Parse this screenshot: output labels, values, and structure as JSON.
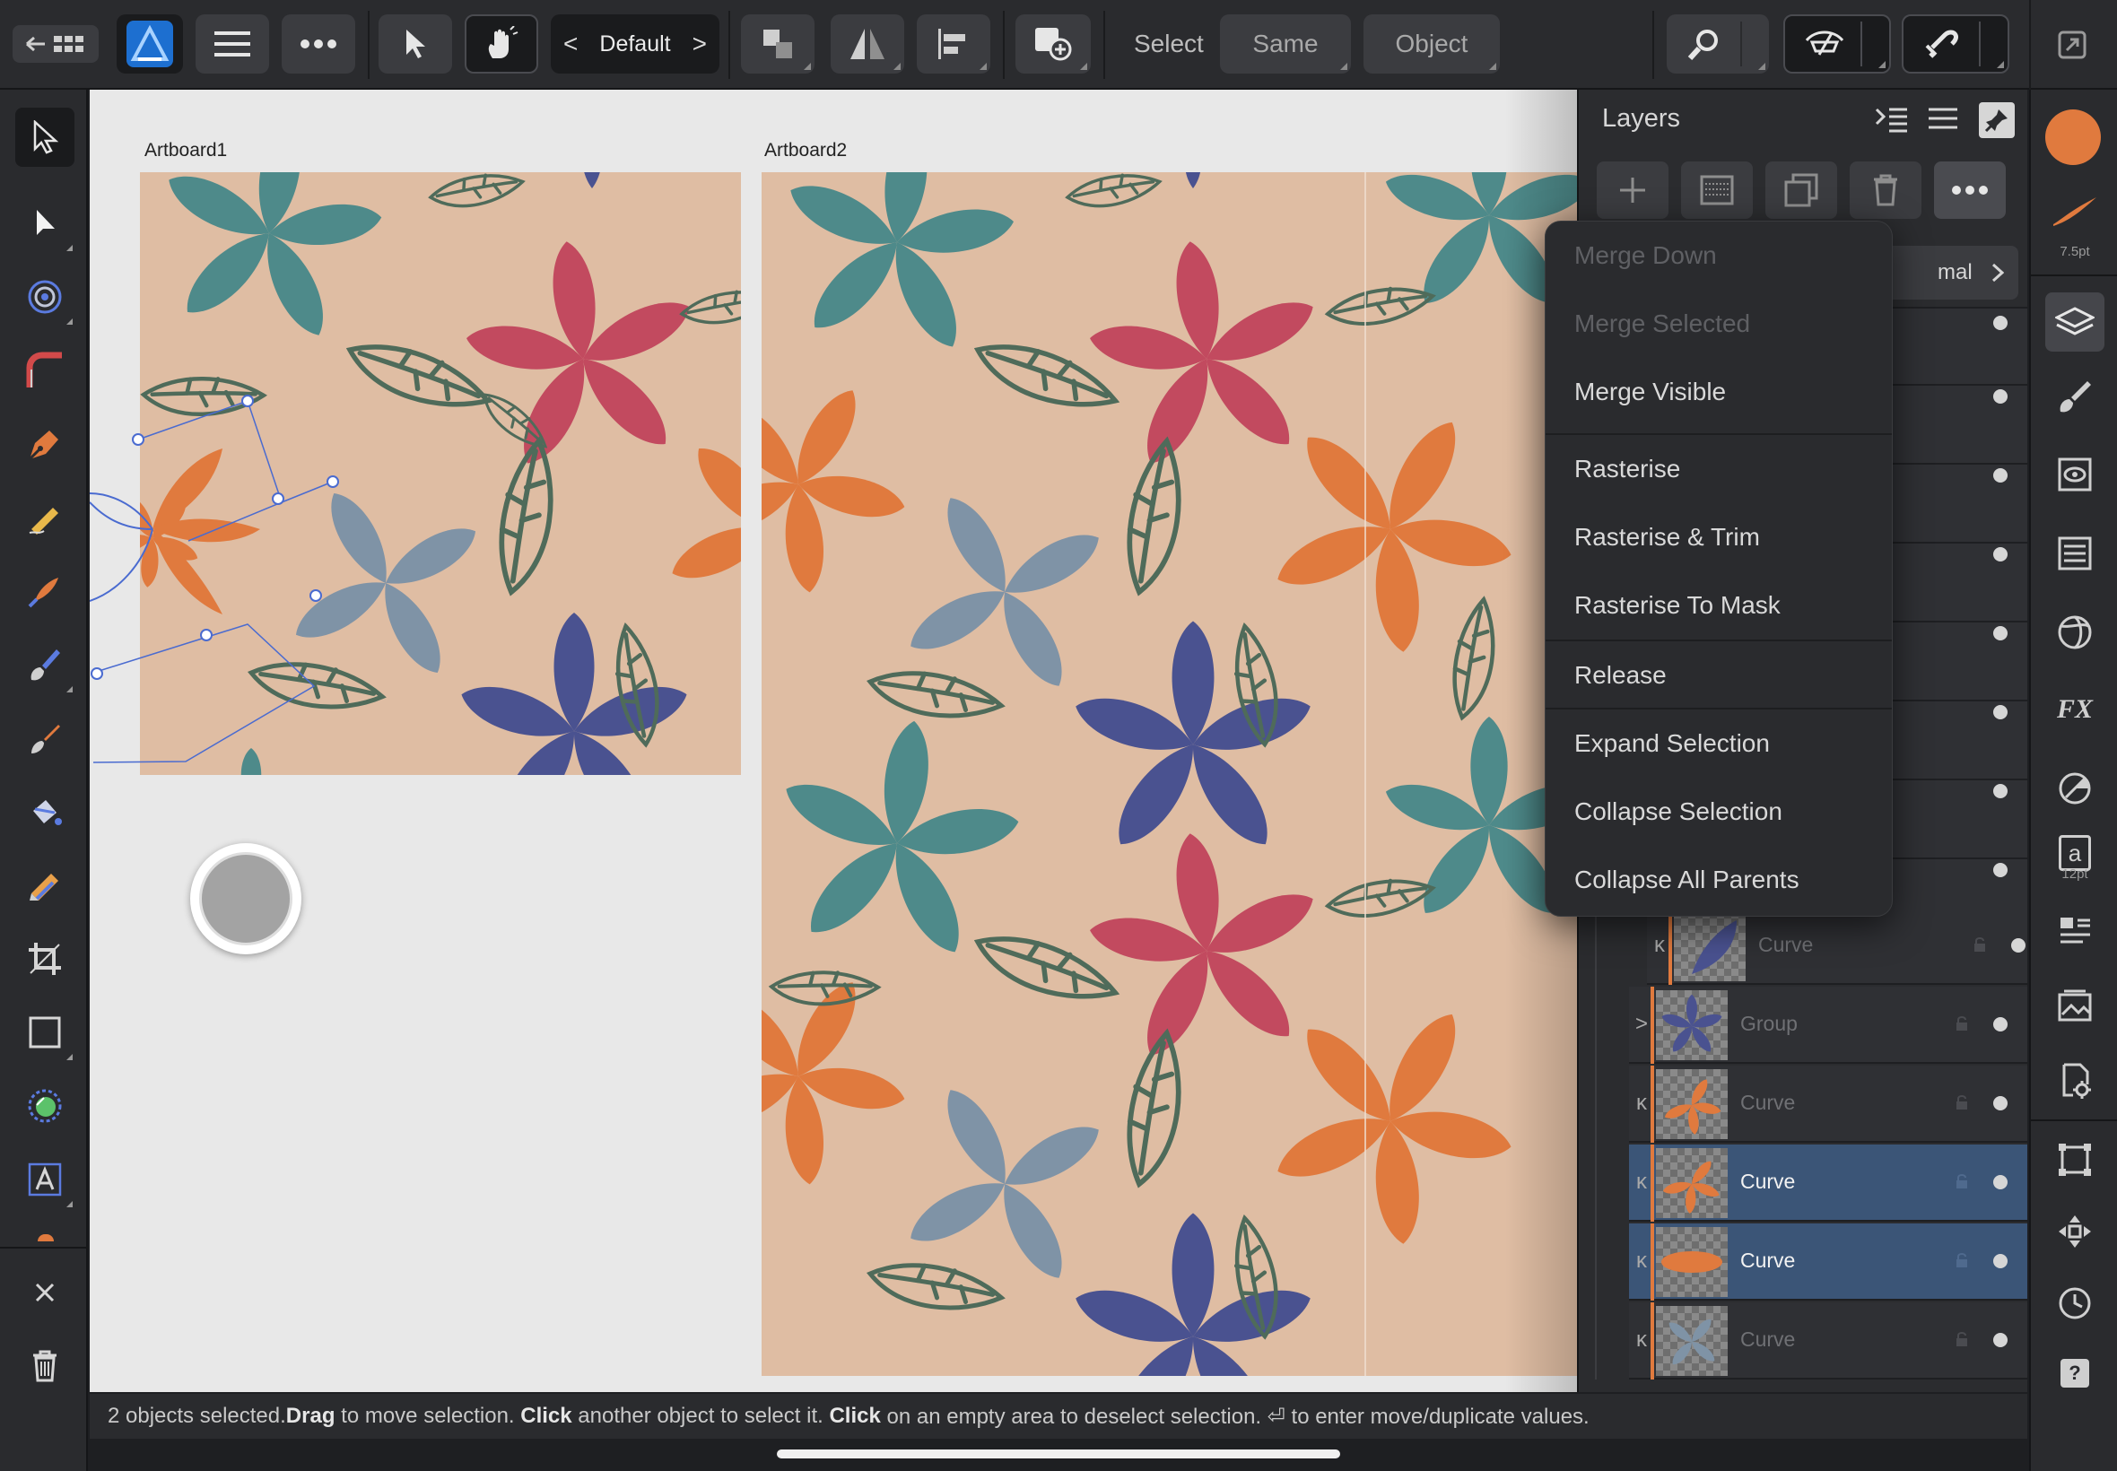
{
  "toolbar": {
    "back_icon": "back-grid-icon",
    "persona": "designer-persona-icon",
    "menu_icon": "hamburger-icon",
    "more_icon": "ellipsis-icon",
    "move_tool_icon": "pointer-icon",
    "gesture_icon": "hand-gesture-icon",
    "preset_prev": "<",
    "preset_label": "Default",
    "preset_next": ">",
    "select_label": "Select",
    "same_label": "Same",
    "object_label": "Object"
  },
  "artboards": [
    {
      "label": "Artboard1"
    },
    {
      "label": "Artboard2"
    }
  ],
  "layers_panel": {
    "title": "Layers",
    "blend_mode_partial": "mal",
    "rows": [
      {
        "name": "Curve",
        "selected": false,
        "expander": "ĸ"
      },
      {
        "name": "Group",
        "selected": false,
        "expander": ">"
      },
      {
        "name": "Curve",
        "selected": false,
        "expander": "ĸ"
      },
      {
        "name": "Curve",
        "selected": true,
        "expander": "ĸ"
      },
      {
        "name": "Curve",
        "selected": true,
        "expander": "ĸ"
      },
      {
        "name": "Curve",
        "selected": false,
        "expander": "ĸ"
      }
    ]
  },
  "context_menu": {
    "items": [
      {
        "label": "Merge Down",
        "enabled": false
      },
      {
        "label": "Merge Selected",
        "enabled": false
      },
      {
        "label": "Merge Visible",
        "enabled": true
      },
      {
        "label": "Rasterise",
        "enabled": true
      },
      {
        "label": "Rasterise & Trim",
        "enabled": true
      },
      {
        "label": "Rasterise To Mask",
        "enabled": true
      },
      {
        "label": "Release",
        "enabled": true
      },
      {
        "label": "Expand Selection",
        "enabled": true
      },
      {
        "label": "Collapse Selection",
        "enabled": true
      },
      {
        "label": "Collapse All Parents",
        "enabled": true
      }
    ]
  },
  "right_bar": {
    "stroke_size": "7.5pt",
    "text_size": "12pt",
    "text_glyph": "a",
    "fx_label": "FX",
    "help_glyph": "?"
  },
  "status": {
    "part1": "2 objects selected. ",
    "bold1": "Drag",
    "part2": " to move selection. ",
    "bold2": "Click",
    "part3": " another object to select it. ",
    "bold3": "Click",
    "part4": " on an empty area to deselect selection. ⏎ to enter move/duplicate values."
  },
  "colors": {
    "accent_orange": "#e07a3e",
    "selection_blue": "#3b5577",
    "pattern_bg": "#dfbda3",
    "teal": "#4e8a8a",
    "crimson": "#c24a5f",
    "slate": "#7f93a6",
    "indigo": "#4a5290",
    "leaf": "#4f6b5a"
  }
}
